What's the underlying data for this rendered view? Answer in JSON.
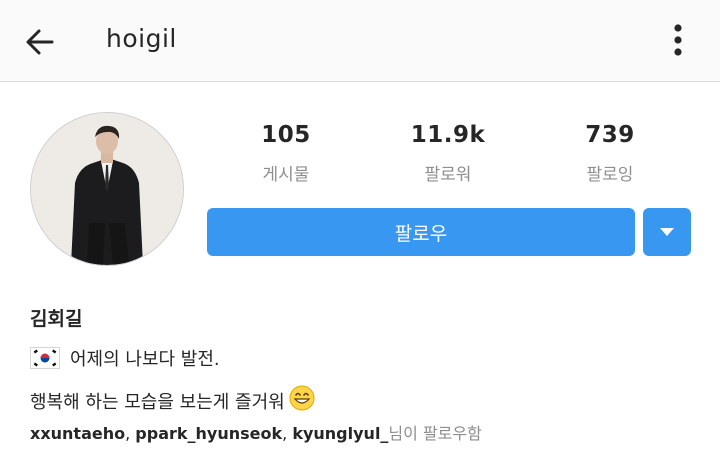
{
  "header": {
    "username": "hoigil"
  },
  "stats": [
    {
      "value": "105",
      "label": "게시물"
    },
    {
      "value": "11.9k",
      "label": "팔로워"
    },
    {
      "value": "739",
      "label": "팔로잉"
    }
  ],
  "actions": {
    "follow_label": "팔로우"
  },
  "bio": {
    "name": "김회길",
    "line1": "어제의 나보다 발전.",
    "line2": "행복해 하는 모습을 보는게 즐거워",
    "flag_icon": "south-korea-flag-icon",
    "emoji_icon": "grinning-face-emoji"
  },
  "followed_by": {
    "users": [
      "xxuntaeho",
      "ppark_hyunseok",
      "kyunglyul_"
    ],
    "separator": ",",
    "suffix": "님이 팔로우함"
  },
  "colors": {
    "accent": "#3897f0",
    "muted": "#8e8e8e",
    "text": "#262626"
  }
}
